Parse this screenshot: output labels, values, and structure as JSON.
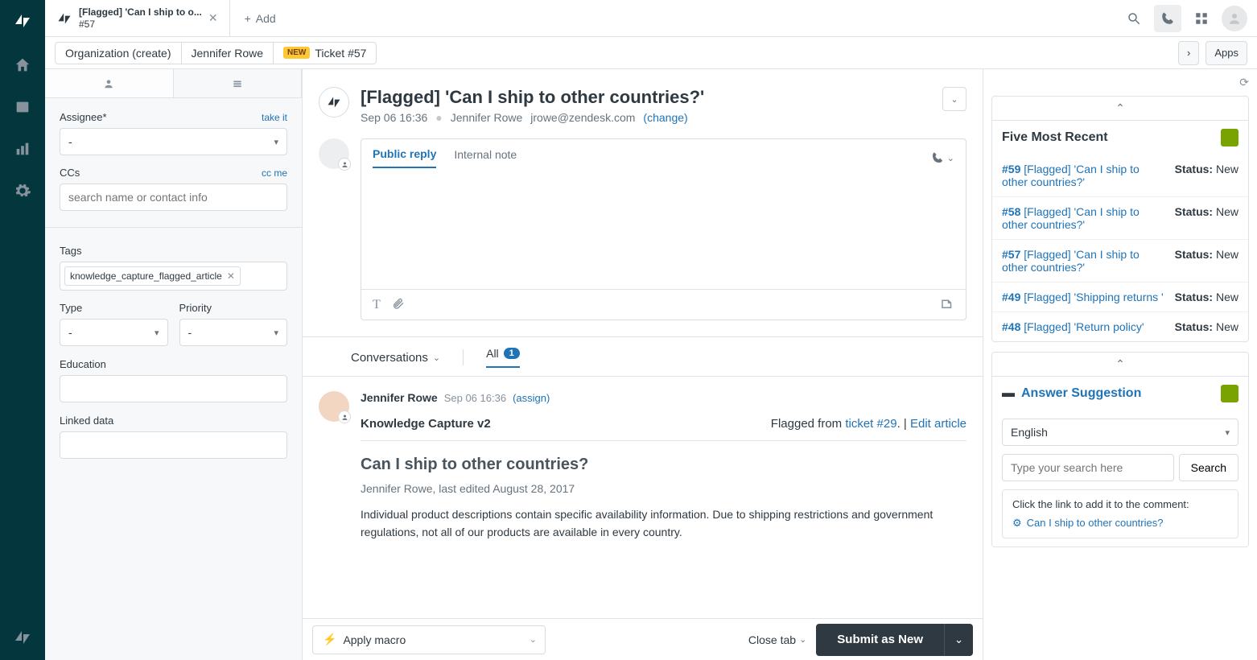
{
  "tab": {
    "title_l1": "[Flagged] 'Can I ship to o...",
    "title_l2": "#57",
    "add": "Add"
  },
  "breadcrumb": {
    "org": "Organization (create)",
    "user": "Jennifer Rowe",
    "new_pill": "NEW",
    "ticket": "Ticket #57",
    "apps": "Apps"
  },
  "leftPanel": {
    "assignee_label": "Assignee*",
    "assignee_link": "take it",
    "assignee_value": "-",
    "ccs_label": "CCs",
    "ccs_link": "cc me",
    "ccs_placeholder": "search name or contact info",
    "tags_label": "Tags",
    "tag_value": "knowledge_capture_flagged_article",
    "type_label": "Type",
    "type_value": "-",
    "priority_label": "Priority",
    "priority_value": "-",
    "education_label": "Education",
    "linked_label": "Linked data"
  },
  "ticket": {
    "title": "[Flagged] 'Can I ship to other countries?'",
    "timestamp": "Sep 06 16:36",
    "requester": "Jennifer Rowe",
    "email": "jrowe@zendesk.com",
    "change": "(change)"
  },
  "reply": {
    "tab_public": "Public reply",
    "tab_internal": "Internal note"
  },
  "conversations": {
    "label": "Conversations",
    "all": "All",
    "count": "1",
    "author": "Jennifer Rowe",
    "ts": "Sep 06 16:36",
    "assign": "(assign)",
    "kc_title": "Knowledge Capture v2",
    "flagged_prefix": "Flagged from ",
    "flagged_link": "ticket #29",
    "flagged_sep": ". | ",
    "edit_link": "Edit article",
    "article_title": "Can I ship to other countries?",
    "article_meta": "Jennifer Rowe, last edited August 28, 2017",
    "article_body": "Individual product descriptions contain specific availability information. Due to shipping restrictions and government regulations, not all of our products are available in every country."
  },
  "footer": {
    "macro": "Apply macro",
    "close": "Close tab",
    "submit": "Submit as New"
  },
  "recent": {
    "title": "Five Most Recent",
    "items": [
      {
        "id": "#59",
        "title": "[Flagged] 'Can I ship to other countries?'",
        "status": "New"
      },
      {
        "id": "#58",
        "title": "[Flagged] 'Can I ship to other countries?'",
        "status": "New"
      },
      {
        "id": "#57",
        "title": "[Flagged] 'Can I ship to other countries?'",
        "status": "New"
      },
      {
        "id": "#49",
        "title": "[Flagged] 'Shipping returns '",
        "status": "New"
      },
      {
        "id": "#48",
        "title": "[Flagged] 'Return policy'",
        "status": "New"
      }
    ],
    "status_label": "Status:"
  },
  "answer": {
    "title": "Answer Suggestion",
    "lang": "English",
    "search_placeholder": "Type your search here",
    "search_btn": "Search",
    "hint": "Click the link to add it to the comment:",
    "link": "Can I ship to other countries?"
  }
}
